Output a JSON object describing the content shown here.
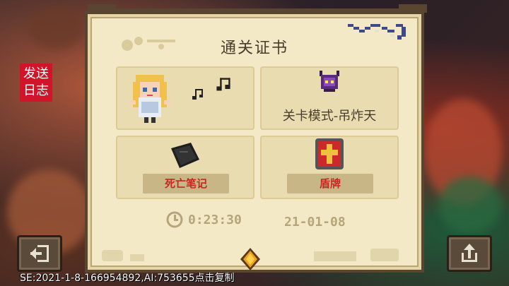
{
  "send_log": {
    "line1": "发送",
    "line2": "日志"
  },
  "certificate": {
    "title": "通关证书",
    "mode_label": "关卡模式-吊炸天",
    "items": [
      {
        "label": "死亡笔记",
        "icon": "death-note-icon"
      },
      {
        "label": "盾牌",
        "icon": "shield-icon"
      }
    ],
    "time": "0:23:30",
    "date": "21-01-08"
  },
  "footer": {
    "seed_text": "SE:2021-1-8-166954892,AI:753655点击复制"
  },
  "colors": {
    "parchment": "#f3e9c6",
    "panel": "#e9dcb0",
    "item_label_bg": "#c9b686",
    "item_label_text": "#c8281f",
    "send_log_bg": "#d0152a",
    "button_bg": "#5a4a3a"
  }
}
